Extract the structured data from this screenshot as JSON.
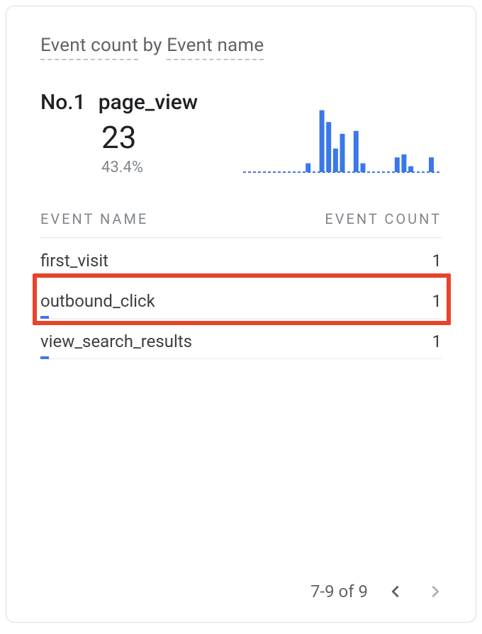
{
  "title": {
    "metric": "Event count",
    "by": "by",
    "dimension": "Event name"
  },
  "hero": {
    "rank_label": "No.1",
    "name": "page_view",
    "value": "23",
    "pct": "43.4%"
  },
  "columns": {
    "name": "EVENT NAME",
    "count": "EVENT COUNT"
  },
  "rows": [
    {
      "name": "first_visit",
      "count": "1",
      "bar_pct": 0
    },
    {
      "name": "outbound_click",
      "count": "1",
      "bar_pct": 2.2,
      "highlight": true
    },
    {
      "name": "view_search_results",
      "count": "1",
      "bar_pct": 2.2
    }
  ],
  "pager": {
    "range_text": "7-9 of 9"
  },
  "chart_data": {
    "type": "bar",
    "title": "Event count sparkline",
    "xlabel": "",
    "ylabel": "",
    "ylim": [
      0,
      25
    ],
    "values": [
      0,
      0,
      0,
      0,
      0,
      0,
      0,
      0,
      0,
      3,
      0,
      21,
      17,
      8,
      13,
      0,
      14,
      3,
      0,
      0,
      0,
      0,
      5,
      6,
      2,
      0,
      0,
      5,
      0
    ]
  },
  "colors": {
    "accent": "#3b78e7",
    "highlight": "#e8432b"
  }
}
